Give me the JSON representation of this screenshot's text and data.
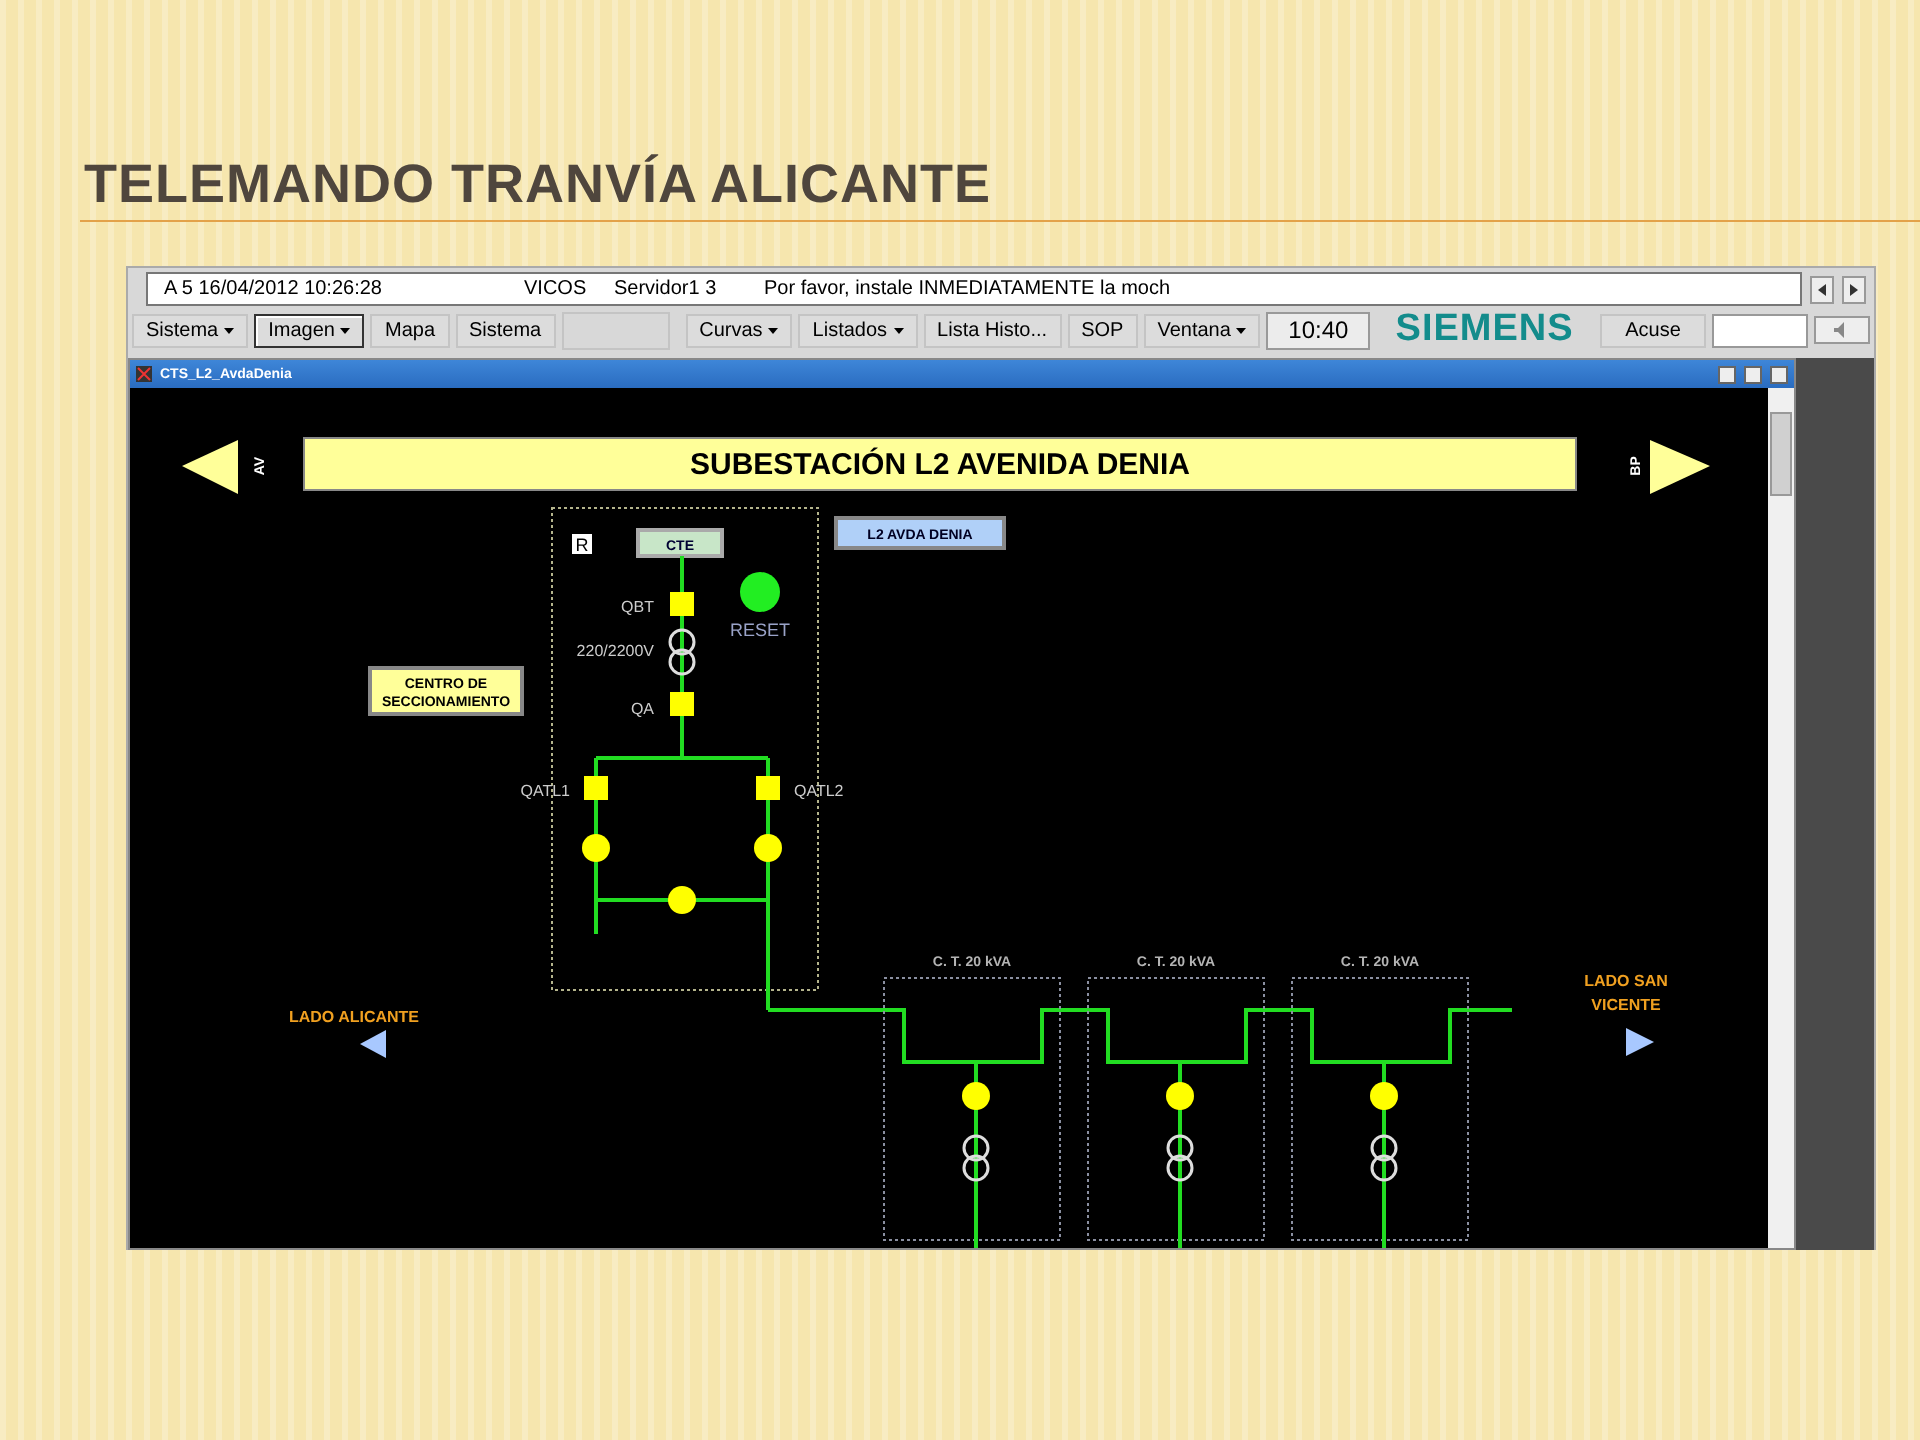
{
  "slide_title": "TELEMANDO TRANVÍA ALICANTE",
  "status_line": {
    "alarm": "A 5 16/04/2012 10:26:28",
    "system": "VICOS",
    "server": "Servidor1 3",
    "message": "Por favor, instale INMEDIATAMENTE la moch"
  },
  "toolbar": [
    {
      "label": "Sistema",
      "dropdown": true,
      "selected": false
    },
    {
      "label": "Imagen",
      "dropdown": true,
      "selected": true
    },
    {
      "label": "Mapa",
      "dropdown": false,
      "selected": false
    },
    {
      "label": "Sistema",
      "dropdown": false,
      "selected": false
    },
    {
      "label": "Curvas",
      "dropdown": true,
      "selected": false
    },
    {
      "label": "Listados",
      "dropdown": true,
      "selected": false
    },
    {
      "label": "Lista Histo...",
      "dropdown": false,
      "selected": false
    },
    {
      "label": "SOP",
      "dropdown": false,
      "selected": false
    },
    {
      "label": "Ventana",
      "dropdown": true,
      "selected": false
    }
  ],
  "clock": "10:40",
  "logo": "SIEMENS",
  "ack_button": "Acuse",
  "window_title": "CTS_L2_AvdaDenia",
  "diagram": {
    "title": "SUBESTACIÓN L2 AVENIDA DENIA",
    "left_nav": "AV",
    "right_nav": "BP",
    "remote_flag": "R",
    "cte": "CTE",
    "line_name": "L2 AVDA DENIA",
    "section_centre": [
      "CENTRO DE",
      "SECCIONAMIENTO"
    ],
    "qbt": "QBT",
    "voltage": "220/2200V",
    "qa": "QA",
    "qatl1": "QATL1",
    "qatl2": "QATL2",
    "reset": {
      "label": "RESET",
      "on": true
    },
    "transformer_stations": [
      "C. T.  20 kVA",
      "C. T.  20 kVA",
      "C. T.  20 kVA"
    ],
    "side_left": "LADO ALICANTE",
    "side_right": [
      "LADO SAN",
      "VICENTE"
    ]
  }
}
